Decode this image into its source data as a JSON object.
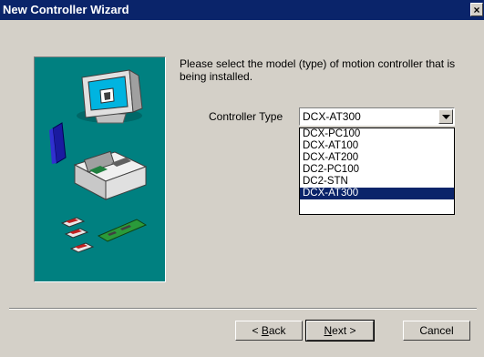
{
  "window": {
    "title": "New Controller Wizard",
    "close_glyph": "×"
  },
  "instruction": "Please select the model (type) of motion controller that is being installed.",
  "controller_type": {
    "label": "Controller Type",
    "selected": "DCX-AT300",
    "options": [
      "DCX-PC100",
      "DCX-AT100",
      "DCX-AT200",
      "DC2-PC100",
      "DC2-STN",
      "DCX-AT300"
    ],
    "highlighted": "DCX-AT300"
  },
  "buttons": {
    "back": {
      "prefix": "< ",
      "mnemonic": "B",
      "rest": "ack"
    },
    "next": {
      "mnemonic": "N",
      "rest": "ext >"
    },
    "cancel": "Cancel"
  },
  "colors": {
    "title_bar": "#0a246a",
    "dialog": "#d4d0c8",
    "illustration_bg": "#008080",
    "selection": "#0a246a"
  }
}
